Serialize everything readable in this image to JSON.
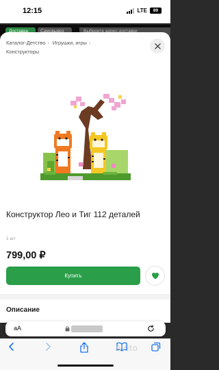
{
  "status_bar": {
    "time": "12:15",
    "network": "LTE",
    "battery": "89"
  },
  "background_page": {
    "tab_active": "Доставка",
    "tab_pickup": "Самовывоз",
    "address_prompt": "Выберите адрес доставки"
  },
  "breadcrumb": {
    "items": [
      "Каталог-Детство",
      "Игрушки, игры",
      "Конструкторы"
    ]
  },
  "product": {
    "title": "Конструктор Лео и Тиг 112 деталей",
    "quantity": "1 шт",
    "price": "799,00 ₽",
    "buy_label": "Купить"
  },
  "description": {
    "heading": "Описание"
  },
  "safari": {
    "text_size_label": "aA"
  },
  "watermark": "Avito",
  "colors": {
    "accent": "#2a9e48",
    "sheet": "#ffffff",
    "backdrop": "#2a2a2a"
  },
  "icons": [
    "chevron-right-icon",
    "close-icon",
    "heart-icon",
    "lock-icon",
    "reload-icon",
    "back-icon",
    "forward-icon",
    "share-icon",
    "bookmarks-icon",
    "tabs-icon"
  ]
}
